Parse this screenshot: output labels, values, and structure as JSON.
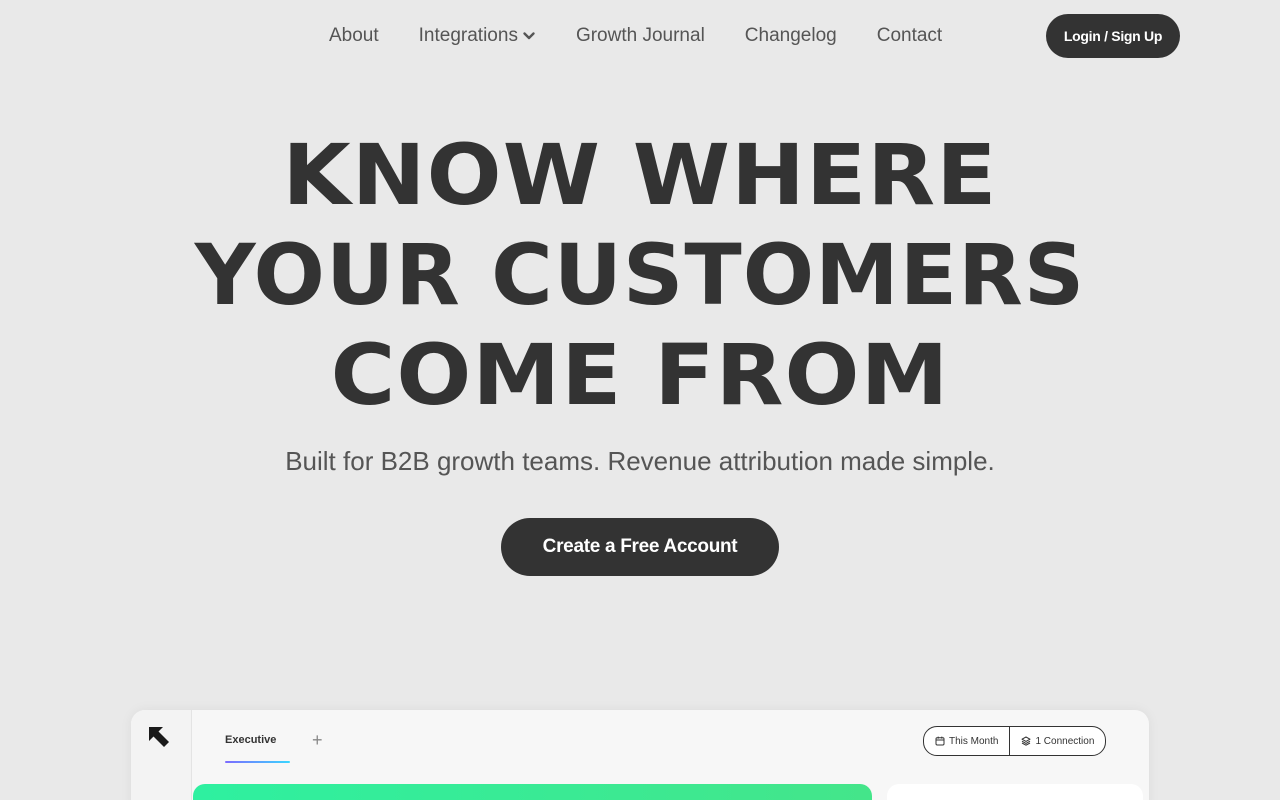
{
  "nav": {
    "links": [
      "About",
      "Integrations",
      "Growth Journal",
      "Changelog",
      "Contact"
    ],
    "login_label": "Login / Sign Up"
  },
  "hero": {
    "title_lines": [
      "KNOW WHERE",
      "YOUR CUSTOMERS",
      "COME FROM"
    ],
    "subtitle": "Built for B2B growth teams. Revenue attribution made simple.",
    "cta_label": "Create a Free Account"
  },
  "preview": {
    "tab_label": "Executive",
    "add_tab_symbol": "+",
    "filters": [
      "This Month",
      "1 Connection"
    ],
    "icons": [
      "logo-arrow-icon",
      "calendar-icon",
      "layers-icon",
      "chevron-down-icon"
    ]
  },
  "colors": {
    "background": "#e9e9e9",
    "dark": "#333333",
    "accent_green": "#2ef0a0"
  }
}
